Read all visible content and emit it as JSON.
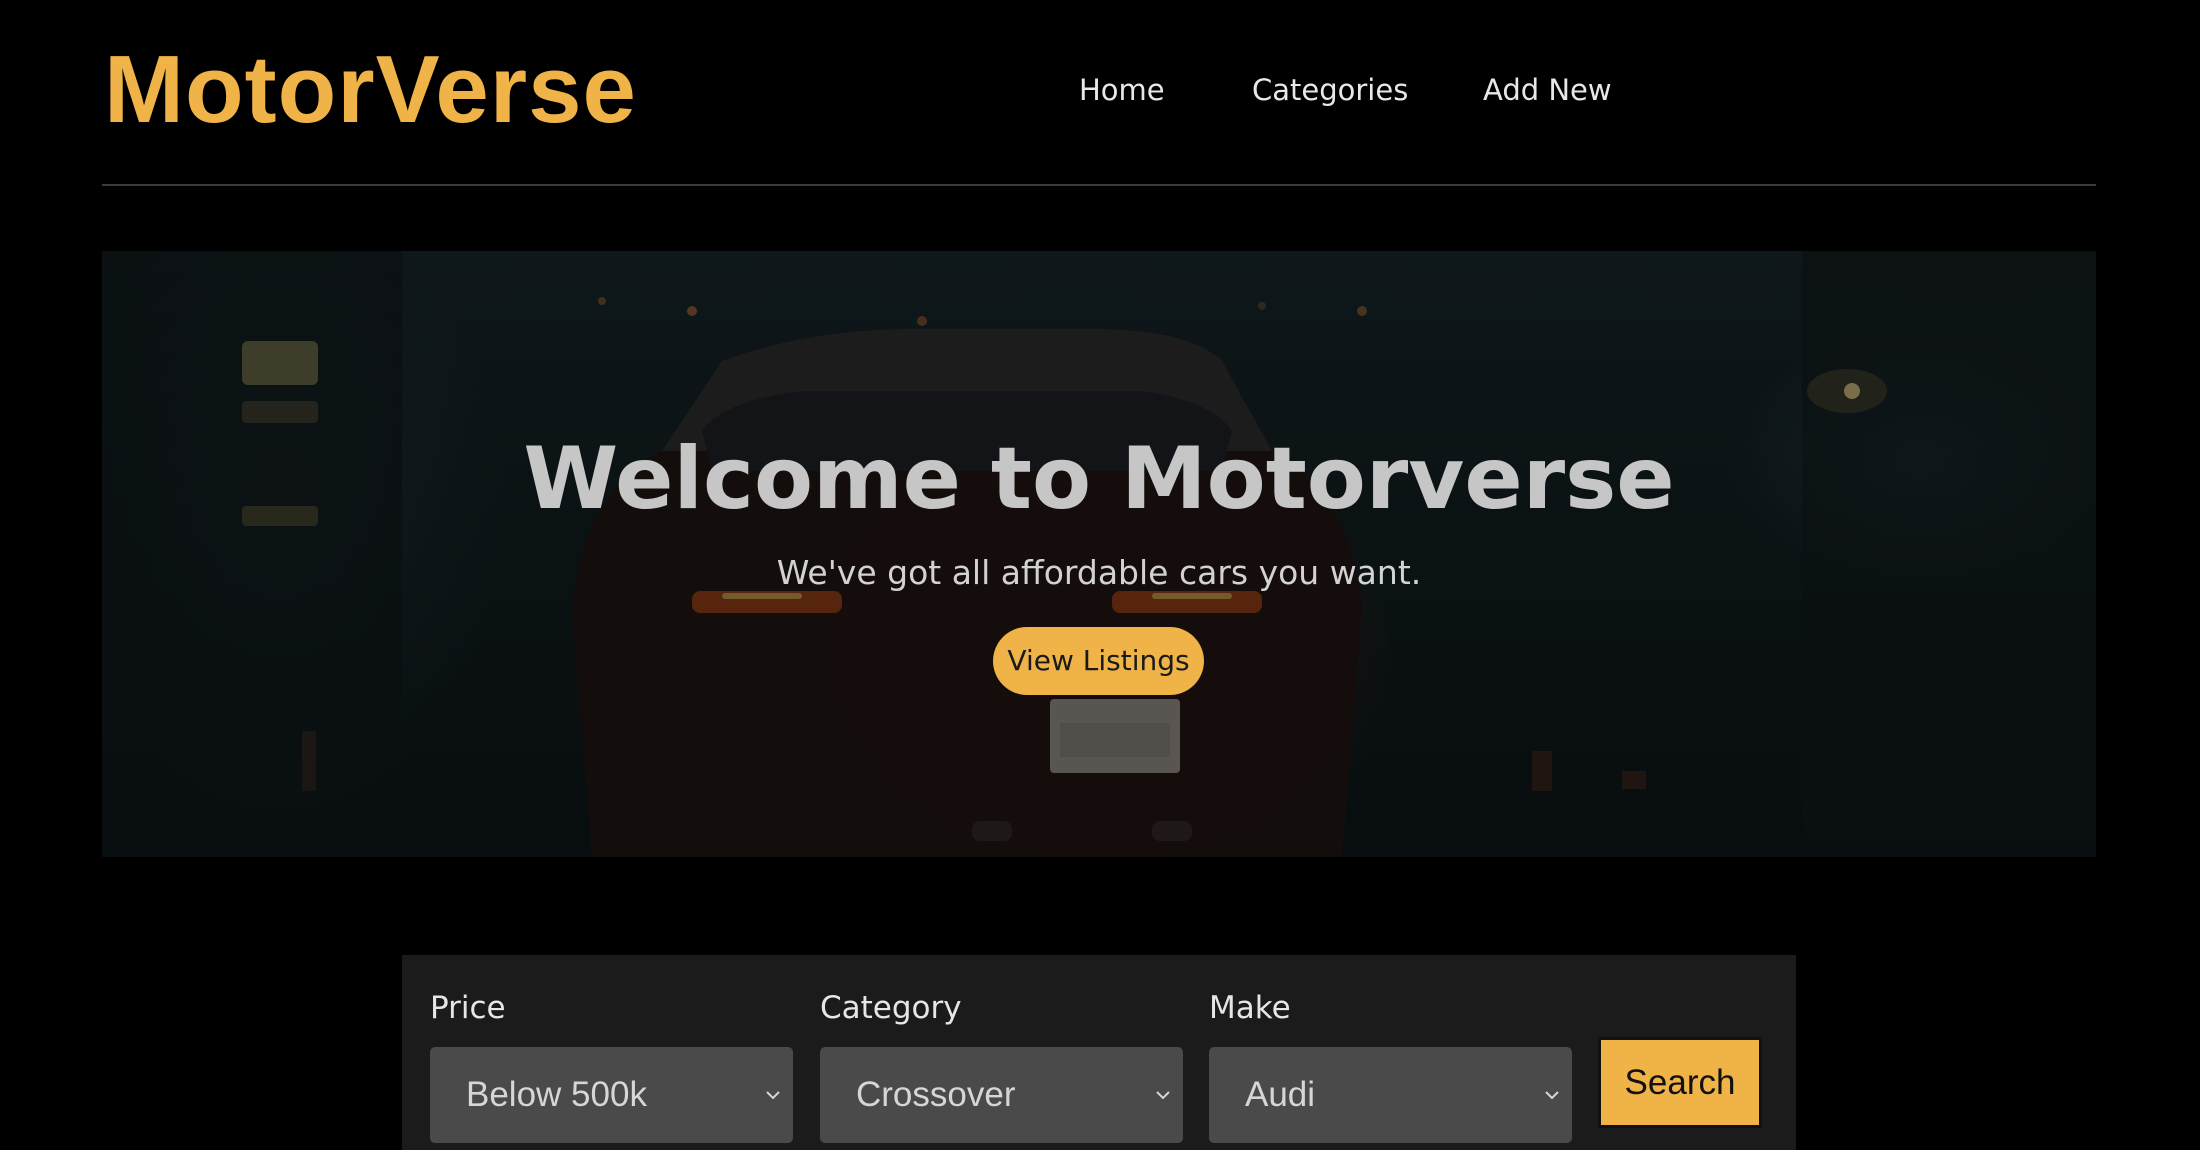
{
  "header": {
    "brand": "MotorVerse",
    "nav": {
      "home": "Home",
      "categories": "Categories",
      "add_new": "Add New"
    }
  },
  "hero": {
    "title": "Welcome to Motorverse",
    "subtitle": "We've got all affordable cars you want.",
    "cta_label": "View Listings"
  },
  "search": {
    "price": {
      "label": "Price",
      "selected": "Below 500k"
    },
    "category": {
      "label": "Category",
      "selected": "Crossover"
    },
    "make": {
      "label": "Make",
      "selected": "Audi"
    },
    "button_label": "Search"
  },
  "colors": {
    "accent": "#f0b347",
    "background": "#000000",
    "panel": "#1b1b1b",
    "select_bg": "#4a4a4a"
  },
  "icons": {
    "select_arrow": "chevron-down-icon"
  }
}
